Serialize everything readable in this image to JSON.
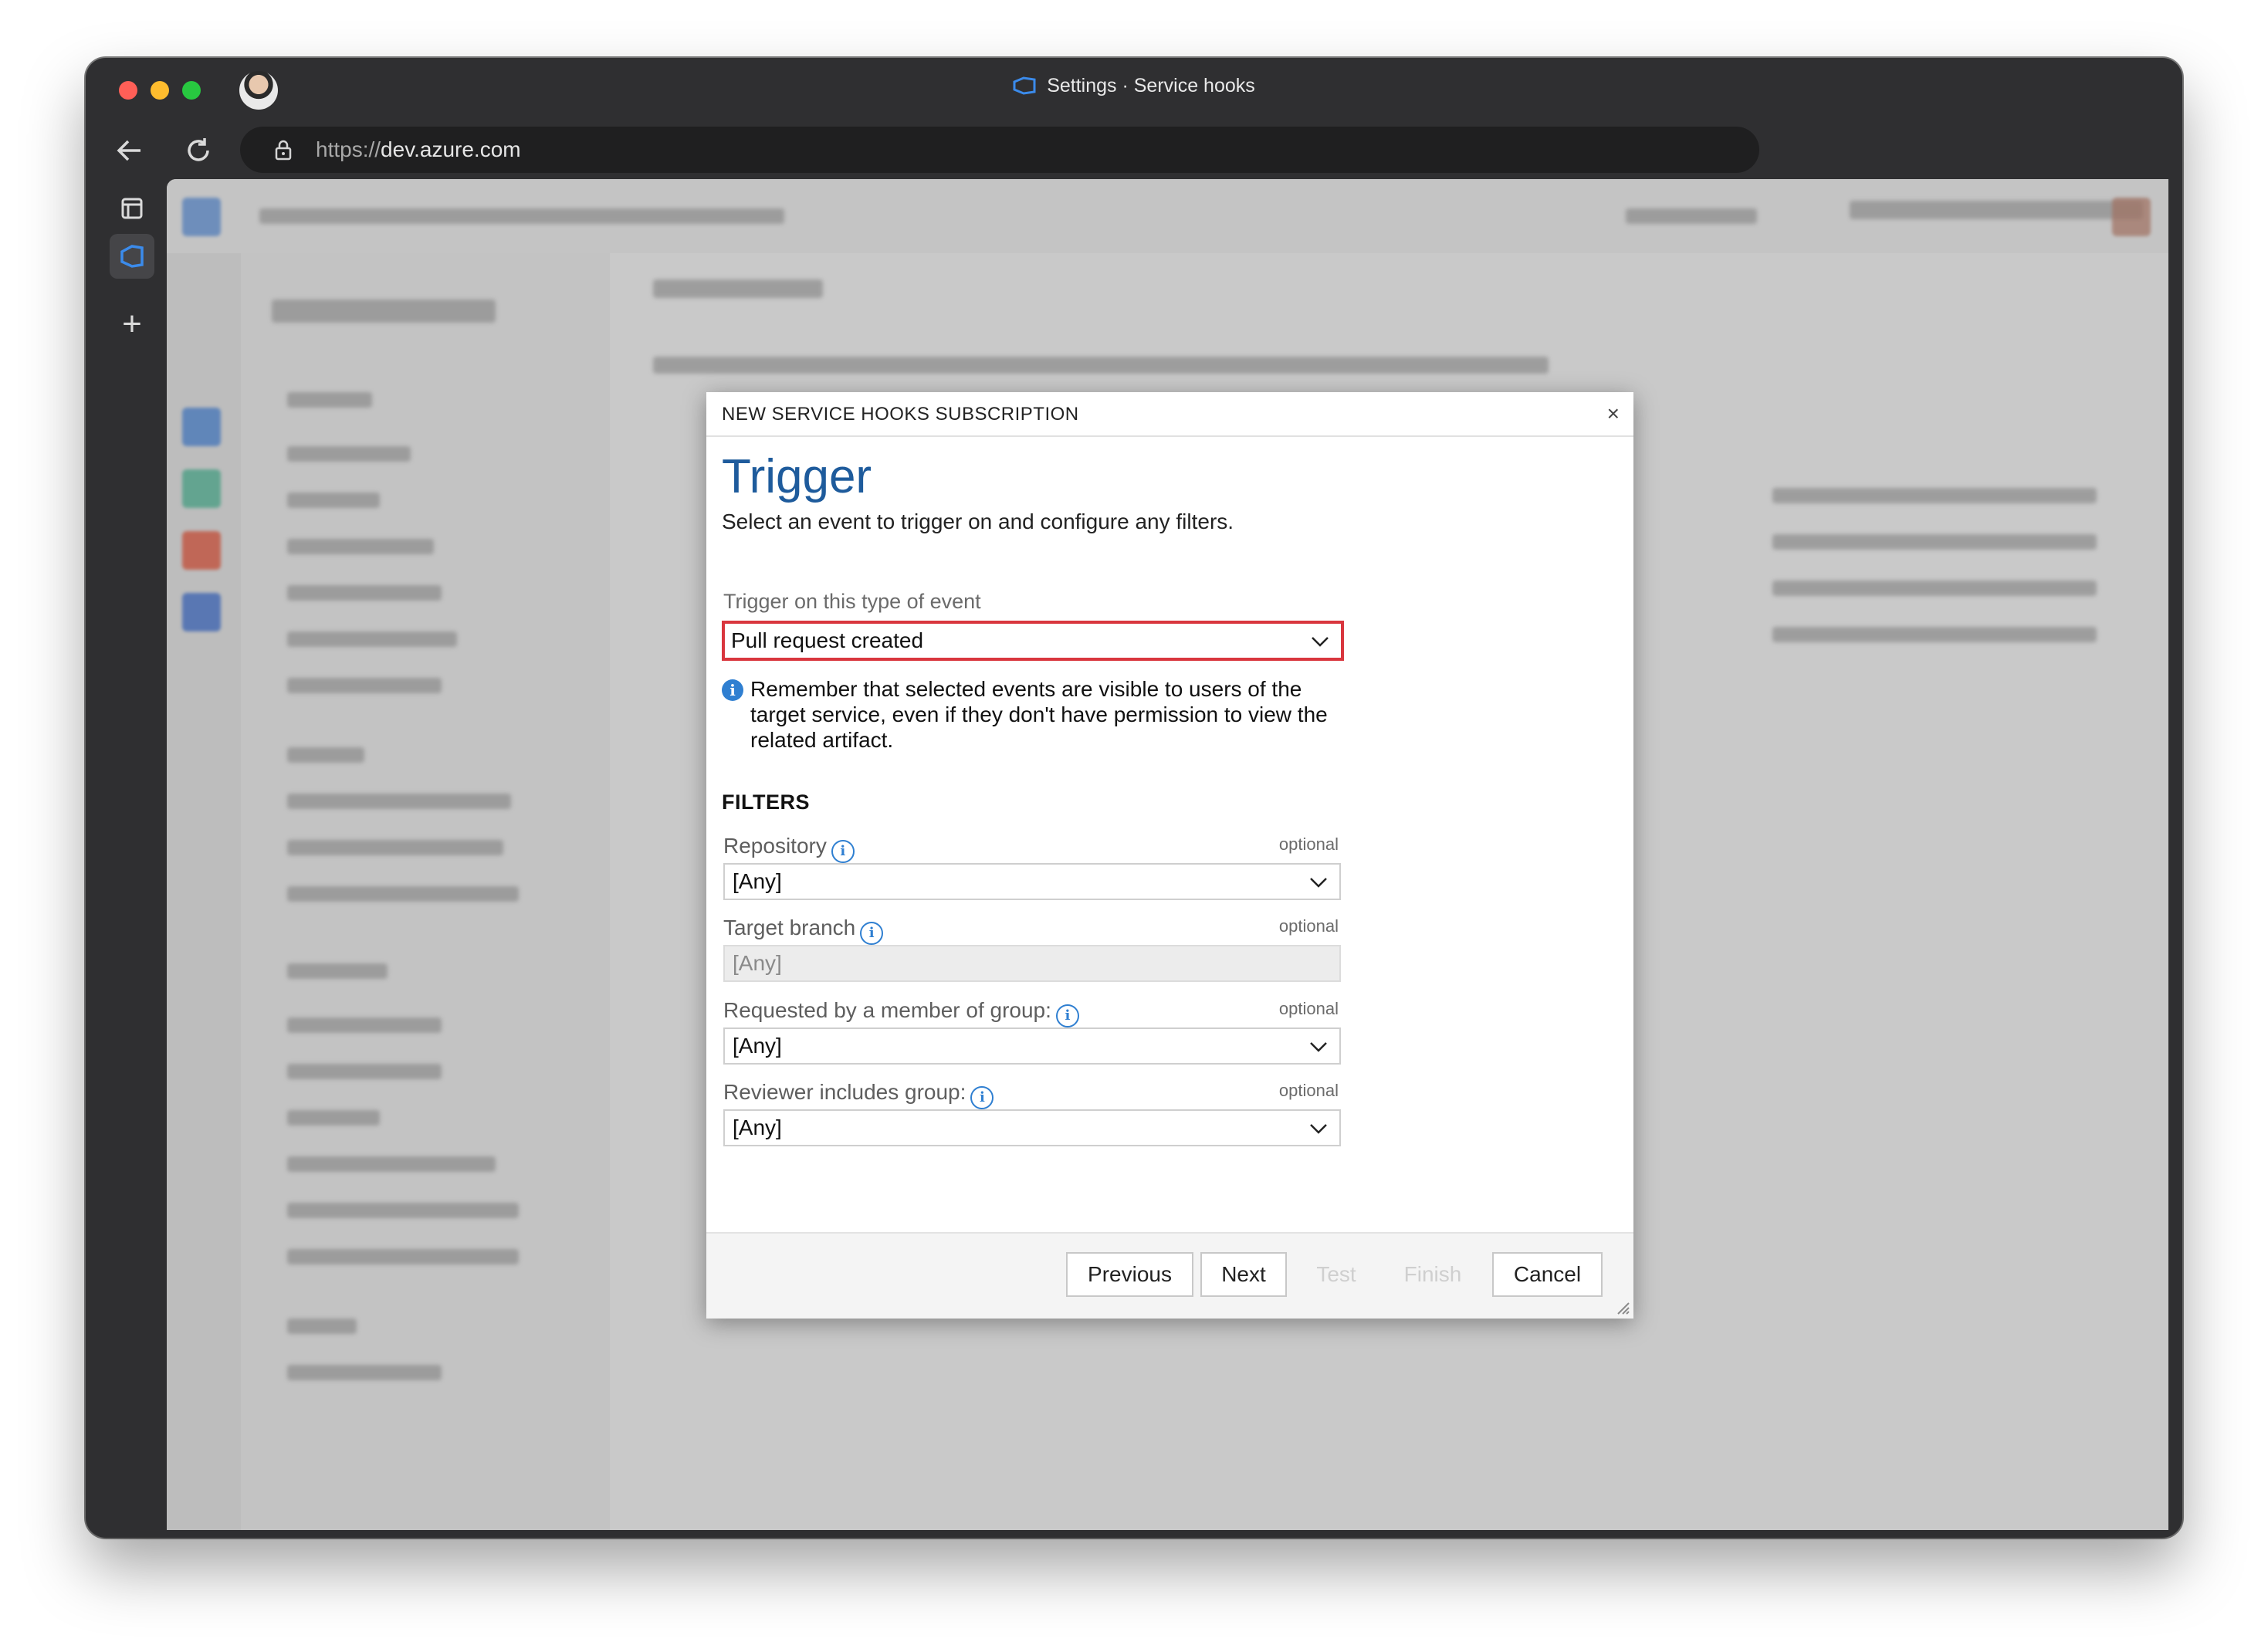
{
  "browser": {
    "window_title": "Settings · Service hooks",
    "url_scheme": "https://",
    "url_host": "dev.azure.com"
  },
  "dialog": {
    "header_title": "NEW SERVICE HOOKS SUBSCRIPTION",
    "close_symbol": "×",
    "step_title": "Trigger",
    "step_subtitle": "Select an event to trigger on and configure any filters.",
    "event_label": "Trigger on this type of event",
    "event_value": "Pull request created",
    "notice": "Remember that selected events are visible to users of the target service, even if they don't have permission to view the related artifact.",
    "filters_heading": "FILTERS",
    "filters": [
      {
        "label": "Repository",
        "optional": "optional",
        "value": "[Any]",
        "disabled": false
      },
      {
        "label": "Target branch",
        "optional": "optional",
        "value": "[Any]",
        "disabled": true
      },
      {
        "label": "Requested by a member of group:",
        "optional": "optional",
        "value": "[Any]",
        "disabled": false
      },
      {
        "label": "Reviewer includes group:",
        "optional": "optional",
        "value": "[Any]",
        "disabled": false
      }
    ],
    "buttons": {
      "previous": "Previous",
      "next": "Next",
      "test": "Test",
      "finish": "Finish",
      "cancel": "Cancel"
    }
  },
  "colors": {
    "accent_blue": "#1e5b9c",
    "highlight_red": "#d9363e",
    "info_blue": "#2f7fd1"
  }
}
